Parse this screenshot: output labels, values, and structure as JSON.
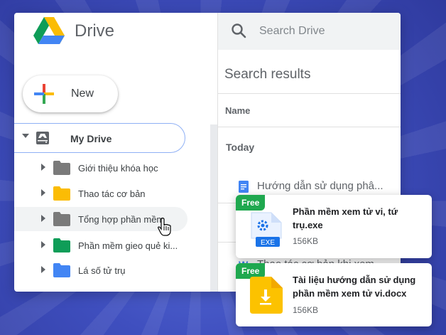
{
  "app": {
    "name": "Drive"
  },
  "sidebar": {
    "new_label": "New",
    "my_drive_label": "My Drive",
    "folders": [
      {
        "label": "Giới thiệu khóa học",
        "color": "#7a7a7a"
      },
      {
        "label": "Thao tác cơ bản",
        "color": "#fbbc04"
      },
      {
        "label": "Tổng hợp phần mềm",
        "color": "#7a7a7a"
      },
      {
        "label": "Phần mềm gieo quẻ ki...",
        "color": "#0f9d58"
      },
      {
        "label": "Lá số tử trụ",
        "color": "#4285f4"
      }
    ]
  },
  "search": {
    "placeholder": "Search Drive"
  },
  "results": {
    "title": "Search results",
    "column_name": "Name",
    "group_today": "Today",
    "files": [
      {
        "label": "Hướng dẫn sử dụng phâ...",
        "icon": "google-doc-icon"
      },
      {
        "label": "Thao tác cơ bản khi xem...",
        "icon": "word-icon"
      }
    ]
  },
  "cards": [
    {
      "badge": "Free",
      "title": "Phần mềm xem tử vi, tứ trụ.exe",
      "icon_label": "EXE",
      "size": "156KB"
    },
    {
      "badge": "Free",
      "title": "Tài liệu hướng dẫn sử dụng phần mềm xem tử vi.docx",
      "size": "156KB"
    }
  ],
  "colors": {
    "badge_green": "#1fa84f",
    "accent_blue": "#1a73e8"
  }
}
